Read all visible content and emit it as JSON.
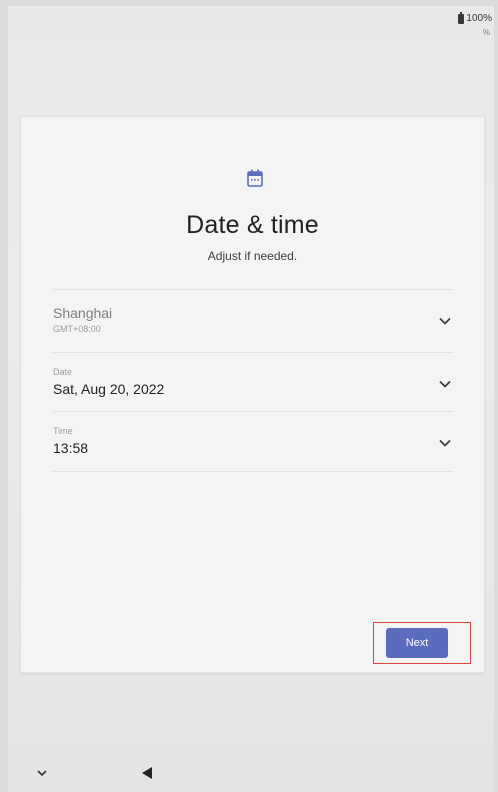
{
  "status_bar": {
    "battery_percent": "100%",
    "secondary": "%"
  },
  "header": {
    "icon": "calendar-icon",
    "title": "Date & time",
    "subtitle": "Adjust if needed."
  },
  "fields": {
    "timezone": {
      "value": "Shanghai",
      "sub": "GMT+08:00",
      "icon": "chevron-down-icon"
    },
    "date": {
      "label": "Date",
      "value": "Sat, Aug 20, 2022",
      "icon": "chevron-down-icon"
    },
    "time": {
      "label": "Time",
      "value": "13:58",
      "icon": "chevron-down-icon"
    }
  },
  "actions": {
    "next_label": "Next"
  },
  "nav": {
    "down_icon": "chevron-down-icon",
    "back_icon": "back-triangle-icon"
  },
  "colors": {
    "accent": "#5b6bbd",
    "highlight_border": "#e0443e",
    "card_bg": "#f4f4f4"
  }
}
